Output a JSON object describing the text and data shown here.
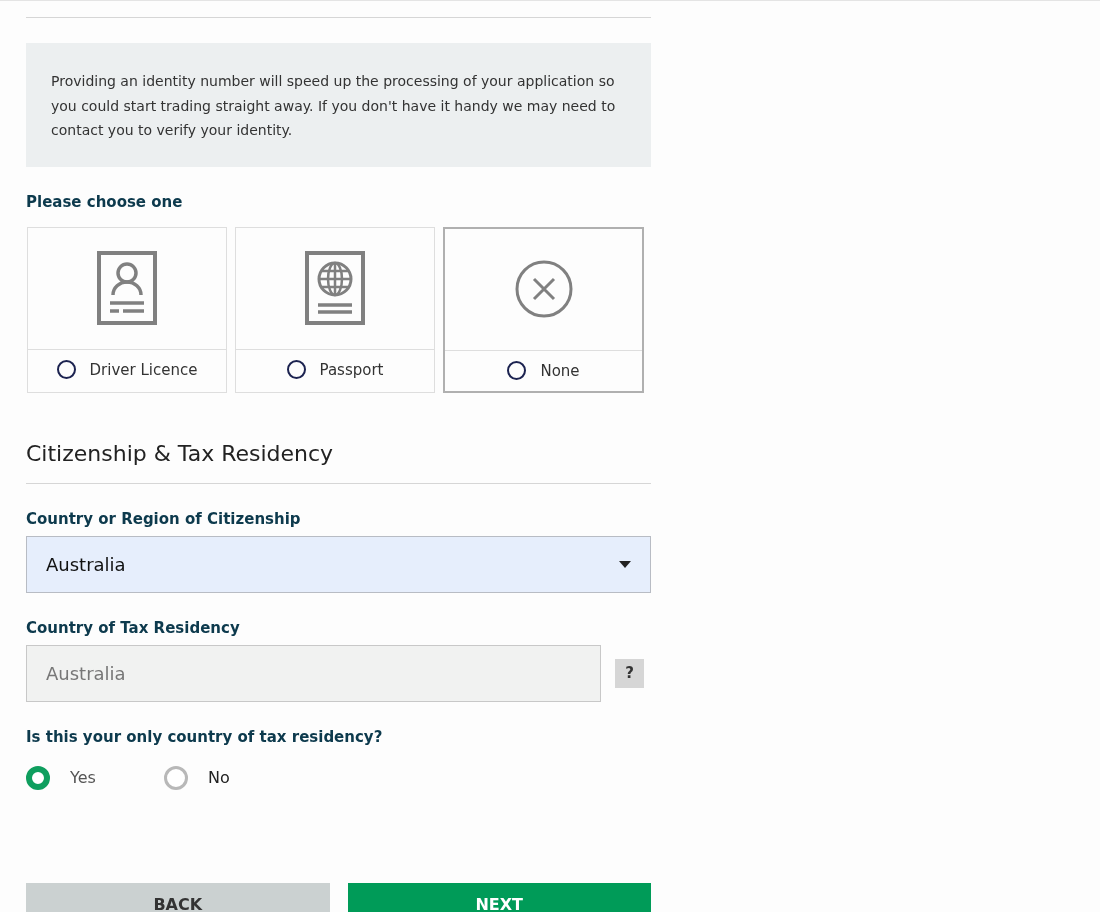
{
  "info_text": "Providing an identity number will speed up the processing of your application so you could start trading straight away. If you don't have it handy we may need to contact you to verify your identity.",
  "id_choice": {
    "label": "Please choose one",
    "options": [
      {
        "kind": "licence",
        "label": "Driver Licence",
        "selected": false,
        "highlighted": false
      },
      {
        "kind": "passport",
        "label": "Passport",
        "selected": false,
        "highlighted": false
      },
      {
        "kind": "none",
        "label": "None",
        "selected": false,
        "highlighted": true
      }
    ]
  },
  "section_title": "Citizenship & Tax Residency",
  "citizenship": {
    "label": "Country or Region of Citizenship",
    "value": "Australia"
  },
  "tax_residency": {
    "label": "Country of Tax Residency",
    "placeholder": "Australia",
    "help": "?"
  },
  "only_country": {
    "label": "Is this your only country of tax residency?",
    "options": [
      {
        "label": "Yes",
        "selected": true
      },
      {
        "label": "No",
        "selected": false
      }
    ]
  },
  "buttons": [
    {
      "kind": "back",
      "label": "BACK"
    },
    {
      "kind": "next",
      "label": "NEXT"
    }
  ]
}
